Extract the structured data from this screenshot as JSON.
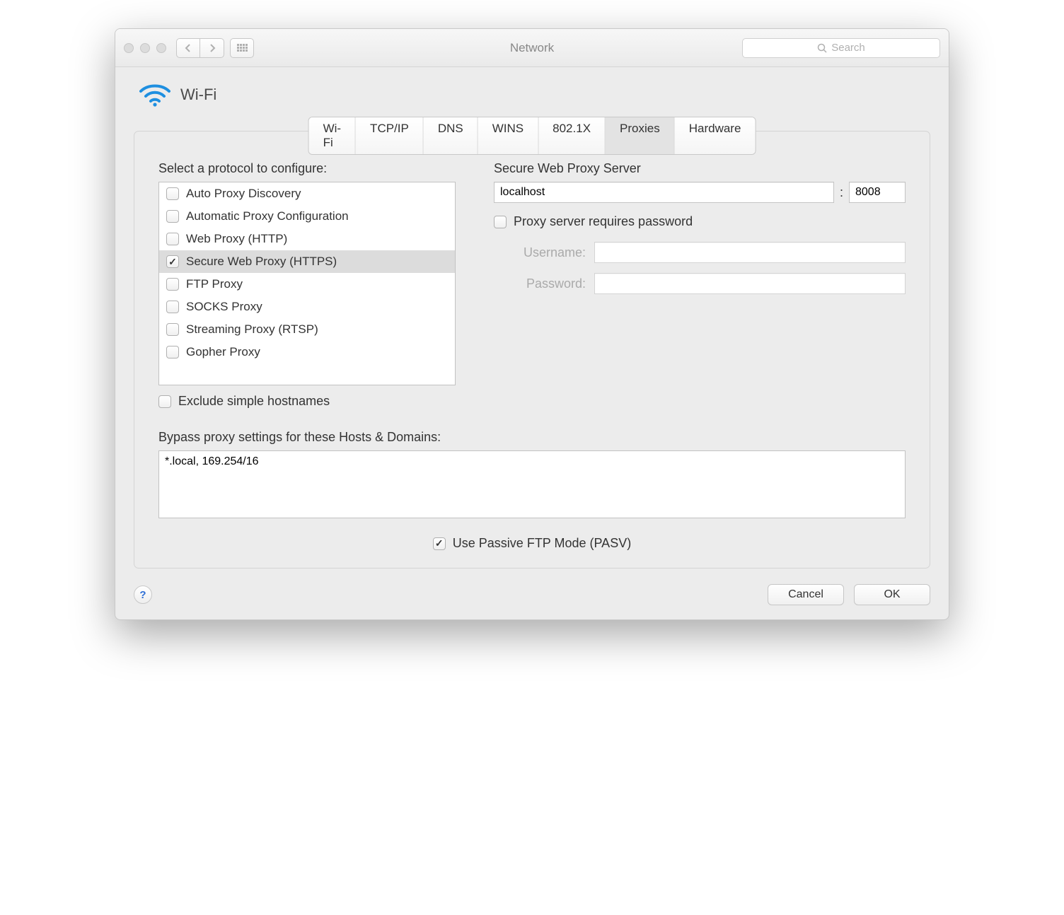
{
  "window": {
    "title": "Network",
    "search_placeholder": "Search"
  },
  "header": {
    "interface_label": "Wi-Fi"
  },
  "tabs": [
    {
      "label": "Wi-Fi",
      "selected": false
    },
    {
      "label": "TCP/IP",
      "selected": false
    },
    {
      "label": "DNS",
      "selected": false
    },
    {
      "label": "WINS",
      "selected": false
    },
    {
      "label": "802.1X",
      "selected": false
    },
    {
      "label": "Proxies",
      "selected": true
    },
    {
      "label": "Hardware",
      "selected": false
    }
  ],
  "left": {
    "select_label": "Select a protocol to configure:",
    "protocols": [
      {
        "label": "Auto Proxy Discovery",
        "checked": false,
        "selected": false
      },
      {
        "label": "Automatic Proxy Configuration",
        "checked": false,
        "selected": false
      },
      {
        "label": "Web Proxy (HTTP)",
        "checked": false,
        "selected": false
      },
      {
        "label": "Secure Web Proxy (HTTPS)",
        "checked": true,
        "selected": true
      },
      {
        "label": "FTP Proxy",
        "checked": false,
        "selected": false
      },
      {
        "label": "SOCKS Proxy",
        "checked": false,
        "selected": false
      },
      {
        "label": "Streaming Proxy (RTSP)",
        "checked": false,
        "selected": false
      },
      {
        "label": "Gopher Proxy",
        "checked": false,
        "selected": false
      }
    ],
    "exclude_label": "Exclude simple hostnames",
    "exclude_checked": false
  },
  "right": {
    "server_label": "Secure Web Proxy Server",
    "host_value": "localhost",
    "port_value": "8008",
    "requires_password_label": "Proxy server requires password",
    "requires_password_checked": false,
    "username_label": "Username:",
    "username_value": "",
    "password_label": "Password:",
    "password_value": ""
  },
  "bypass": {
    "label": "Bypass proxy settings for these Hosts & Domains:",
    "value": "*.local, 169.254/16"
  },
  "pasv": {
    "label": "Use Passive FTP Mode (PASV)",
    "checked": true
  },
  "footer": {
    "cancel_label": "Cancel",
    "ok_label": "OK"
  }
}
